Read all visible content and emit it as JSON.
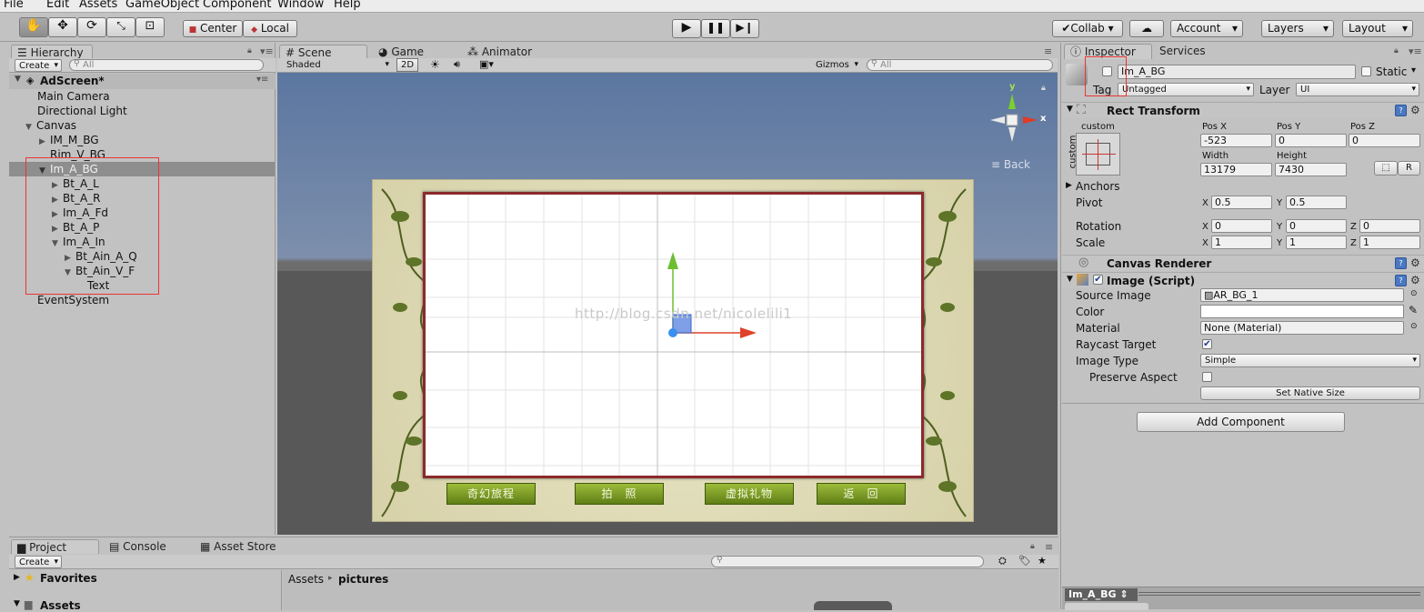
{
  "menu": {
    "file": "File",
    "edit": "Edit",
    "assets": "Assets",
    "gameobject": "GameObject",
    "component": "Component",
    "window": "Window",
    "help": "Help"
  },
  "toolbar": {
    "pivot": "Center",
    "space": "Local",
    "collab": "Collab",
    "account": "Account",
    "layers": "Layers",
    "layout": "Layout"
  },
  "hierarchy": {
    "tab": "Hierarchy",
    "create": "Create",
    "search_placeholder": "All",
    "scene": "AdScreen*",
    "items": [
      "Main Camera",
      "Directional Light",
      "Canvas",
      "IM_M_BG",
      "Rim_V_BG",
      "Im_A_BG",
      "Bt_A_L",
      "Bt_A_R",
      "Im_A_Fd",
      "Bt_A_P",
      "Im_A_In",
      "Bt_Ain_A_Q",
      "Bt_Ain_V_F",
      "Text",
      "EventSystem"
    ]
  },
  "scene": {
    "tabs": [
      "Scene",
      "Game",
      "Animator"
    ],
    "shading": "Shaded",
    "mode2d": "2D",
    "gizmos": "Gizmos",
    "search_placeholder": "All",
    "gizmo_y": "y",
    "gizmo_x": "x",
    "back": "Back",
    "watermark": "http://blog.csdn.net/nicolelili1",
    "buttons": [
      "奇幻旅程",
      "拍　照",
      "虚拟礼物",
      "返　回"
    ]
  },
  "inspector": {
    "tab": "Inspector",
    "services_tab": "Services",
    "name": "Im_A_BG",
    "static": "Static",
    "tag_label": "Tag",
    "tag": "Untagged",
    "layer_label": "Layer",
    "layer": "UI",
    "rect_title": "Rect Transform",
    "custom_top": "custom",
    "custom_side": "custom",
    "pos_x_label": "Pos X",
    "pos_y_label": "Pos Y",
    "pos_z_label": "Pos Z",
    "pos_x": "-523",
    "pos_y": "0",
    "pos_z": "0",
    "width_label": "Width",
    "height_label": "Height",
    "width": "13179",
    "height": "7430",
    "r_button": "R",
    "anchors": "Anchors",
    "pivot": "Pivot",
    "pivot_x": "0.5",
    "pivot_y": "0.5",
    "rotation": "Rotation",
    "rot_x": "0",
    "rot_y": "0",
    "rot_z": "0",
    "scale": "Scale",
    "scale_x": "1",
    "scale_y": "1",
    "scale_z": "1",
    "x": "X",
    "y": "Y",
    "z": "Z",
    "canvas_renderer": "Canvas Renderer",
    "image_title": "Image (Script)",
    "source_image_label": "Source Image",
    "source_image": "AR_BG_1",
    "color_label": "Color",
    "material_label": "Material",
    "material": "None (Material)",
    "raycast_label": "Raycast Target",
    "image_type_label": "Image Type",
    "image_type": "Simple",
    "preserve_label": "Preserve Aspect",
    "native_size": "Set Native Size",
    "add_component": "Add Component",
    "preview_title": "Im_A_BG"
  },
  "bottom": {
    "project_tab": "Project",
    "console_tab": "Console",
    "asset_store_tab": "Asset Store",
    "create": "Create",
    "favorites": "Favorites",
    "assets": "Assets",
    "breadcrumb_root": "Assets",
    "breadcrumb_sep": "▸",
    "breadcrumb_leaf": "pictures"
  }
}
